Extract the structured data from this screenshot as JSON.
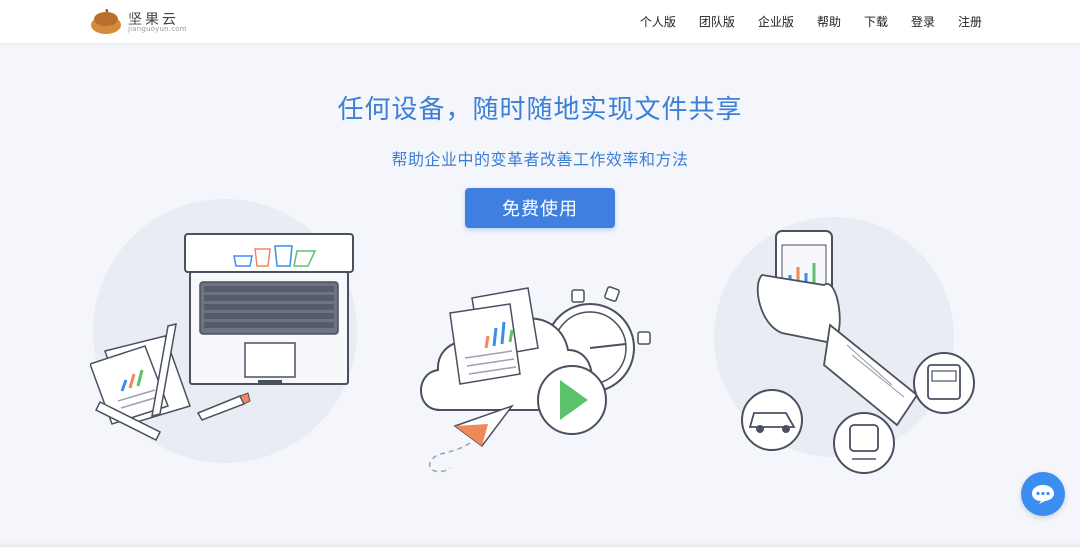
{
  "brand": {
    "name": "坚果云",
    "sub": "jianguoyun.com"
  },
  "nav": {
    "items": [
      "个人版",
      "团队版",
      "企业版",
      "帮助",
      "下载",
      "登录",
      "注册"
    ]
  },
  "hero": {
    "title": "任何设备，随时随地实现文件共享",
    "subtitle": "帮助企业中的变革者改善工作效率和方法",
    "cta": "免费使用"
  },
  "icons": {
    "chat": "chat-bubble-icon",
    "logo": "acorn-logo-icon"
  },
  "colors": {
    "accent": "#3f7fe0",
    "title": "#3d7fd4"
  }
}
